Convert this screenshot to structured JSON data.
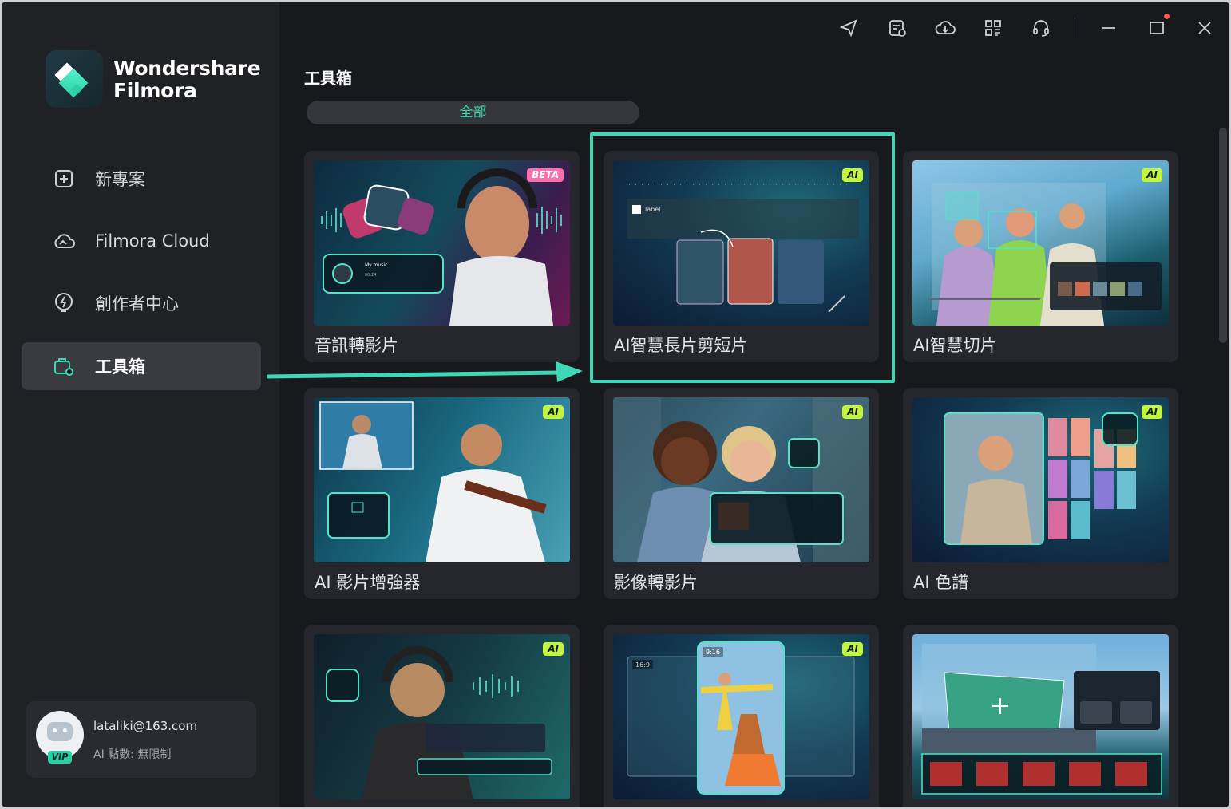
{
  "app": {
    "brand_line1": "Wondershare",
    "brand_line2": "Filmora"
  },
  "sidebar": {
    "items": [
      {
        "label": "新專案",
        "icon": "new-project-icon",
        "active": false
      },
      {
        "label": "Filmora Cloud",
        "icon": "cloud-icon",
        "active": false
      },
      {
        "label": "創作者中心",
        "icon": "creator-hub-icon",
        "active": false
      },
      {
        "label": "工具箱",
        "icon": "toolbox-icon",
        "active": true
      }
    ]
  },
  "user": {
    "email": "lataliki@163.com",
    "points": "AI 點數: 無限制",
    "badge": "VIP"
  },
  "toolbar": {
    "icons": [
      "send-feedback-icon",
      "task-history-icon",
      "cloud-download-icon",
      "apps-grid-icon",
      "support-headset-icon"
    ],
    "window_controls": [
      "minimize-icon",
      "maximize-icon",
      "close-icon"
    ]
  },
  "main": {
    "title": "工具箱",
    "filter_tab": "全部",
    "cards": [
      {
        "label": "音訊轉影片",
        "badge": "BETA"
      },
      {
        "label": "AI智慧長片剪短片",
        "badge": "AI",
        "highlighted": true
      },
      {
        "label": "AI智慧切片",
        "badge": "AI"
      },
      {
        "label": "AI 影片增強器",
        "badge": "AI"
      },
      {
        "label": "影像轉影片",
        "badge": "AI"
      },
      {
        "label": "AI 色譜",
        "badge": "AI"
      },
      {
        "label": "",
        "badge": "AI"
      },
      {
        "label": "",
        "badge": "AI"
      },
      {
        "label": "",
        "badge": ""
      }
    ]
  },
  "colors": {
    "accent": "#3fd8b7",
    "ai_badge": "#c3f53c",
    "beta_badge": "#ff6fae"
  }
}
